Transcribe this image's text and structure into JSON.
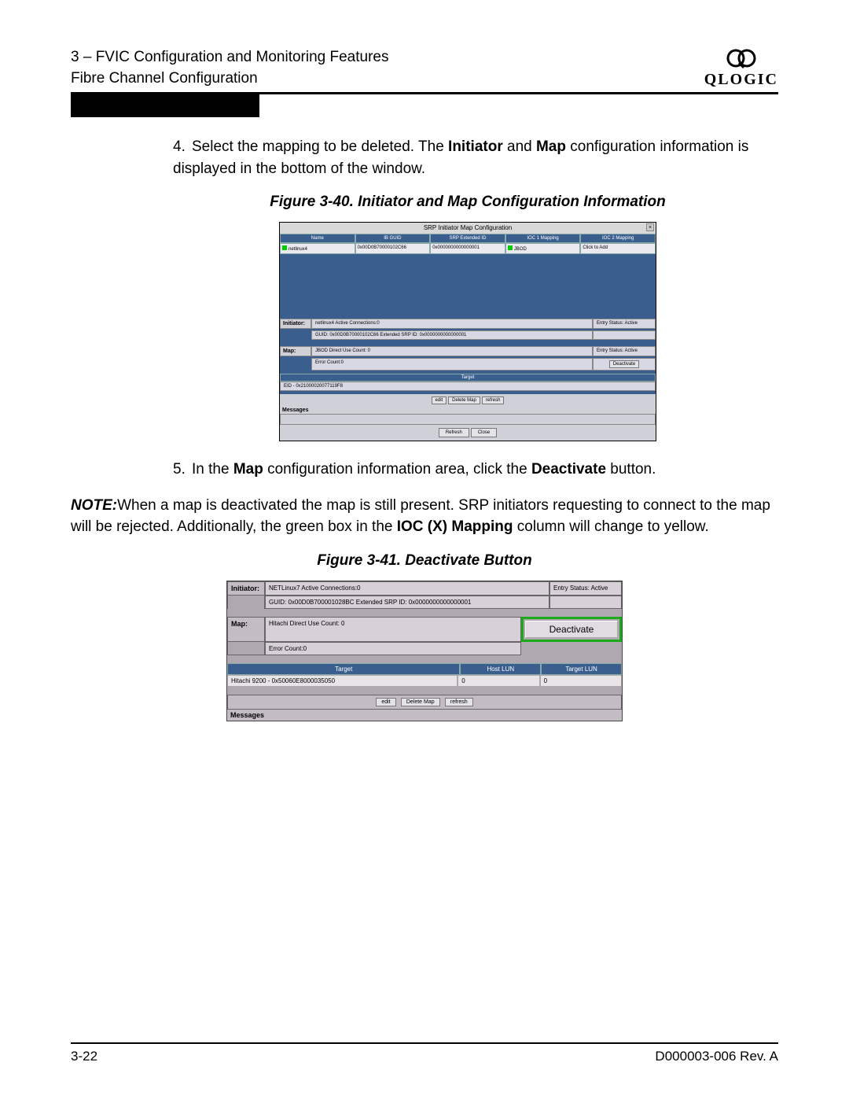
{
  "header": {
    "section": "3 – FVIC Configuration and Monitoring Features",
    "subsection": "Fibre Channel Configuration",
    "brand": "QLOGIC"
  },
  "step4": {
    "num": "4.",
    "text_a": "Select the mapping to be deleted. The ",
    "b1": "Initiator",
    "mid": " and ",
    "b2": "Map",
    "text_b": " configuration information is displayed in the bottom of the window."
  },
  "fig40_caption": "Figure 3-40.  Initiator and Map Configuration Information",
  "fig40": {
    "title": "SRP Initiator Map Configuration",
    "close": "×",
    "cols": [
      "Name",
      "IB GUID",
      "SRP Extended ID",
      "IOC 1 Mapping",
      "IOC 2 Mapping"
    ],
    "row": [
      "netlinux4",
      "0x00D0B70000102C66",
      "0x0000000000000001",
      "JBOD",
      "Click to Add"
    ],
    "initiator_label": "Initiator:",
    "initiator_row": "netlinux4   Active Connections:0",
    "initiator_status": "Entry Status: Active",
    "initiator_guid": "GUID: 0x00D0B70000102C66    Extended SRP ID: 0x0000000000000001",
    "map_label": "Map:",
    "map_row": "JBOD     Direct     Use Count: 0",
    "map_status": "Entry Status: Active",
    "deactivate": "Deactivate",
    "error_count": "Error Count:0",
    "target": "Target",
    "eid": "EID - 0x21000020077119F8",
    "btn_edit": "edit",
    "btn_delete": "Delete Map",
    "btn_refresh_small": "refresh",
    "messages": "Messages",
    "btn_refresh": "Refresh",
    "btn_close": "Close"
  },
  "step5": {
    "num": "5.",
    "text_a": "In the ",
    "b1": "Map",
    "text_b": " configuration information area, click the ",
    "b2": "Deactivate",
    "text_c": " button."
  },
  "note": {
    "label": "NOTE:",
    "text_a": "When a map is deactivated the map is still present. SRP initiators requesting to connect to the map will be rejected. Additionally, the green box in the ",
    "b1": "IOC (X) Mapping",
    "text_b": " column will change to yellow."
  },
  "fig41_caption": "Figure 3-41. Deactivate Button",
  "fig41": {
    "initiator_label": "Initiator:",
    "initiator_row": "NETLinux7   Active Connections:0",
    "initiator_status": "Entry Status: Active",
    "initiator_guid": "GUID: 0x00D0B700001028BC    Extended SRP ID: 0x0000000000000001",
    "map_label": "Map:",
    "map_row": "Hitachi     Direct     Use Count: 0",
    "deactivate": "Deactivate",
    "error_count": "Error Count:0",
    "col_target": "Target",
    "col_host": "Host LUN",
    "col_tlun": "Target LUN",
    "target_row": "Hitachi 9200 - 0x50060E8000035050",
    "host_lun": "0",
    "target_lun": "0",
    "btn_edit": "edit",
    "btn_delete": "Delete Map",
    "btn_refresh": "refresh",
    "messages": "Messages"
  },
  "footer": {
    "page": "3-22",
    "doc": "D000003-006 Rev. A"
  }
}
